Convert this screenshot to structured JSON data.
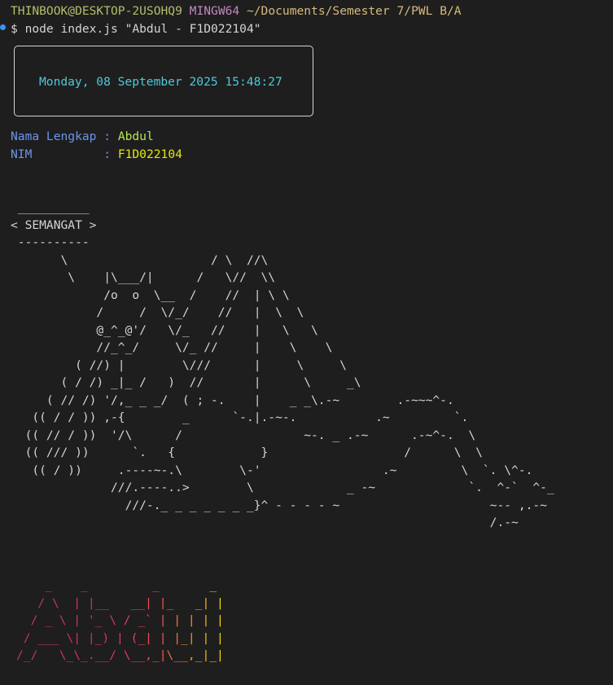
{
  "prompt": {
    "user_host": "THINBOOK@DESKTOP-2USOHQ9",
    "shell": "MINGW64",
    "path": "~/Documents/Semester 7/PWL B/A"
  },
  "command": "$ node index.js \"Abdul - F1D022104\"",
  "datetime": "Monday, 08 September 2025 15:48:27",
  "info": {
    "name_label": "Nama Lengkap :",
    "name_value": "Abdul",
    "nim_label": "NIM          :",
    "nim_value": "F1D022104"
  },
  "cowsay": " __________\n< SEMANGAT >\n ----------\n       \\                    / \\  //\\\n        \\    |\\___/|      /   \\//  \\\\\n             /o  o  \\__  /    //  | \\ \\\n            /     /  \\/_/    //   |  \\  \\\n            @_^_@'/   \\/_   //    |   \\   \\\n            //_^_/     \\/_ //     |    \\    \\\n         ( //) |        \\///      |     \\     \\\n       ( / /) _|_ /   )  //       |      \\     _\\\n     ( // /) '/,_ _ _/  ( ; -.    |    _ _\\.-~        .-~~~^-.\n   (( / / )) ,-{        _      `-.|.-~-.           .~         `.\n  (( // / ))  '/\\      /                 ~-. _ .-~      .-~^-.  \\\n  (( /// ))      `.   {            }                   /      \\  \\\n   (( / ))     .----~-.\\        \\-'                 .~         \\  `. \\^-.\n              ///.----..>        \\             _ -~             `.  ^-`  ^-_\n                ///-._ _ _ _ _ _ _}^ - - - - ~                     ~-- ,.-~\n                                                                   /.-~",
  "figlet": "    _    _         _       _\n   / \\  | |__   __| |_   _| |\n  / _ \\ | '_ \\ / _` | | | | |\n / ___ \\| |_) | (_| | |_| | |\n/_/   \\_\\_.__/ \\__,_|\\__,_|_|"
}
